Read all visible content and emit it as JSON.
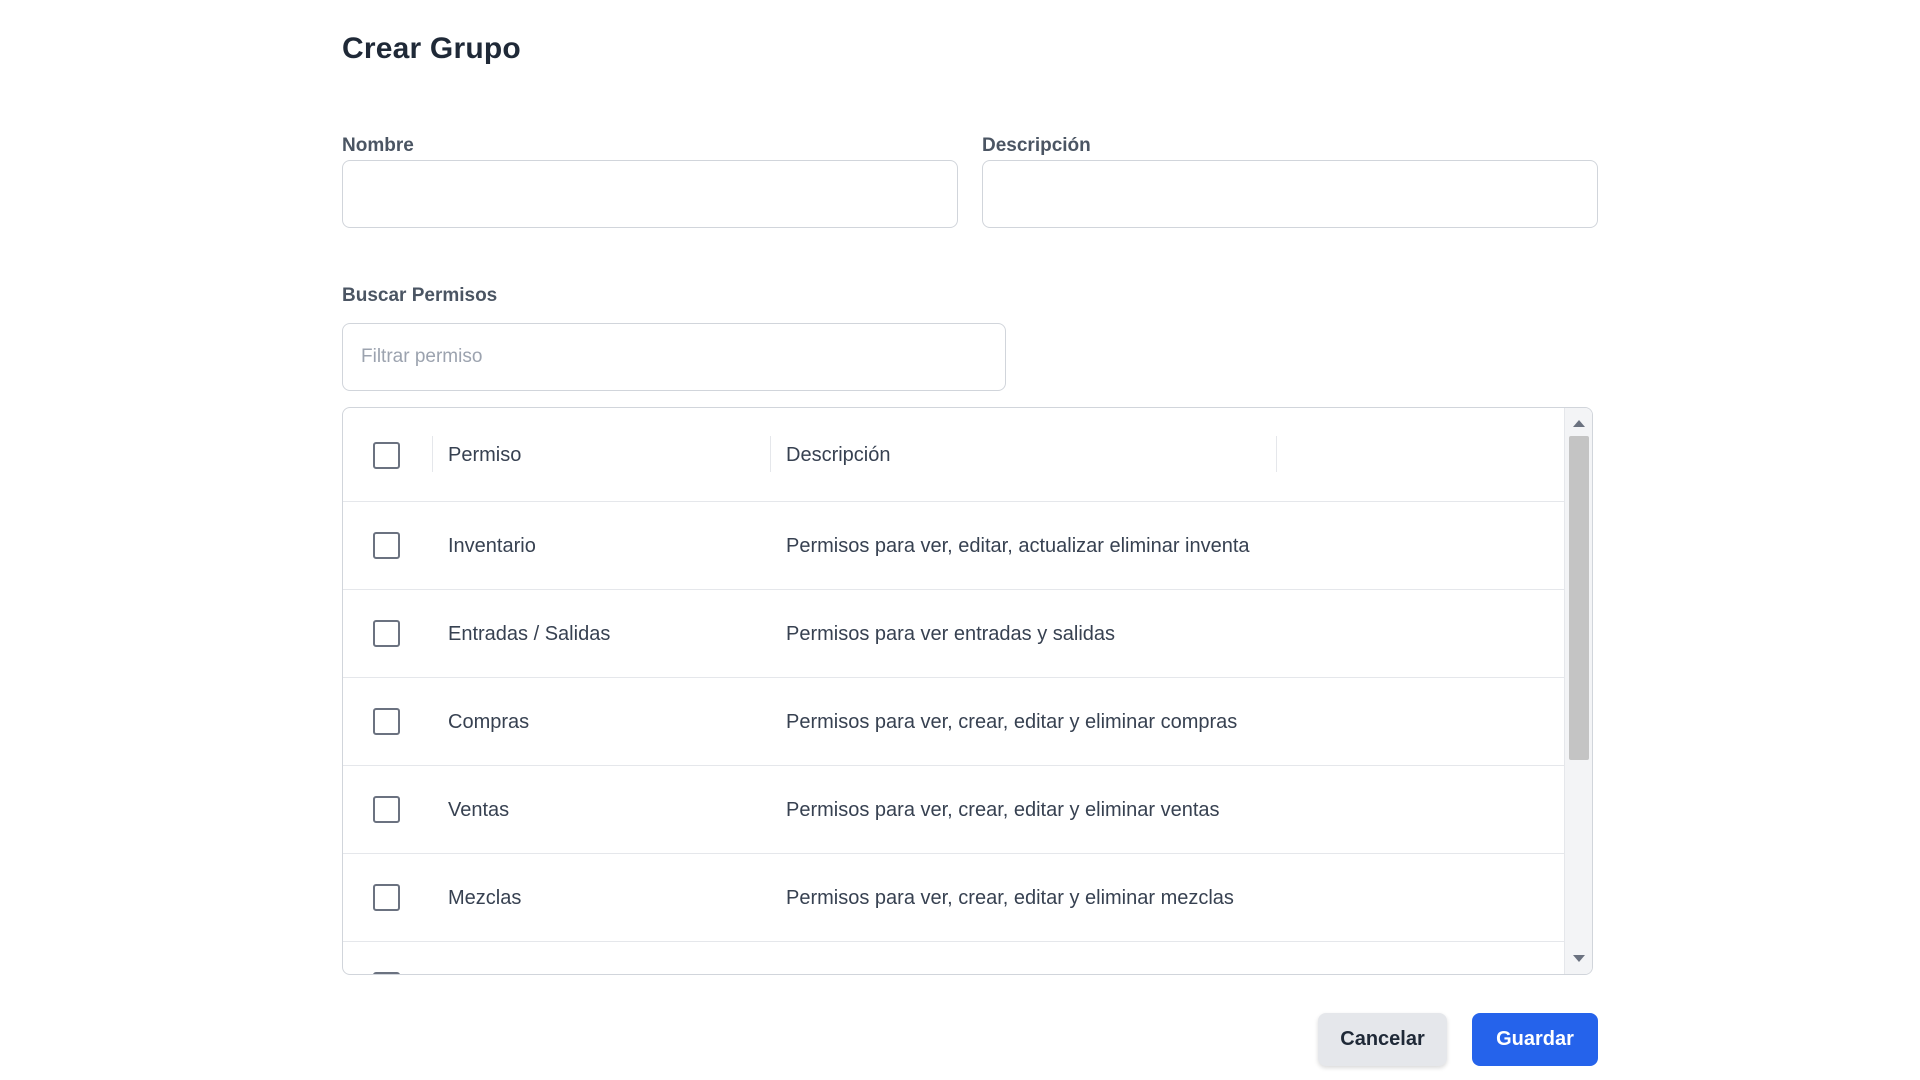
{
  "dialog": {
    "title": "Crear Grupo"
  },
  "form": {
    "name": {
      "label": "Nombre",
      "value": "",
      "placeholder": ""
    },
    "description": {
      "label": "Descripción",
      "value": "",
      "placeholder": ""
    },
    "search": {
      "label": "Buscar Permisos",
      "value": "",
      "placeholder": "Filtrar permiso"
    }
  },
  "table": {
    "columns": [
      "Permiso",
      "Descripción"
    ],
    "rows": [
      {
        "permiso": "Inventario",
        "descripcion": "Permisos para ver, editar, actualizar eliminar inventa"
      },
      {
        "permiso": "Entradas / Salidas",
        "descripcion": "Permisos para ver entradas y salidas"
      },
      {
        "permiso": "Compras",
        "descripcion": "Permisos para ver, crear, editar y eliminar compras"
      },
      {
        "permiso": "Ventas",
        "descripcion": "Permisos para ver, crear, editar y eliminar ventas"
      },
      {
        "permiso": "Mezclas",
        "descripcion": "Permisos para ver, crear, editar y eliminar mezclas"
      }
    ]
  },
  "actions": {
    "cancel_label": "Cancelar",
    "save_label": "Guardar"
  },
  "colors": {
    "primary": "#2563eb",
    "secondary": "#e5e7eb",
    "border": "#d1d5db"
  }
}
